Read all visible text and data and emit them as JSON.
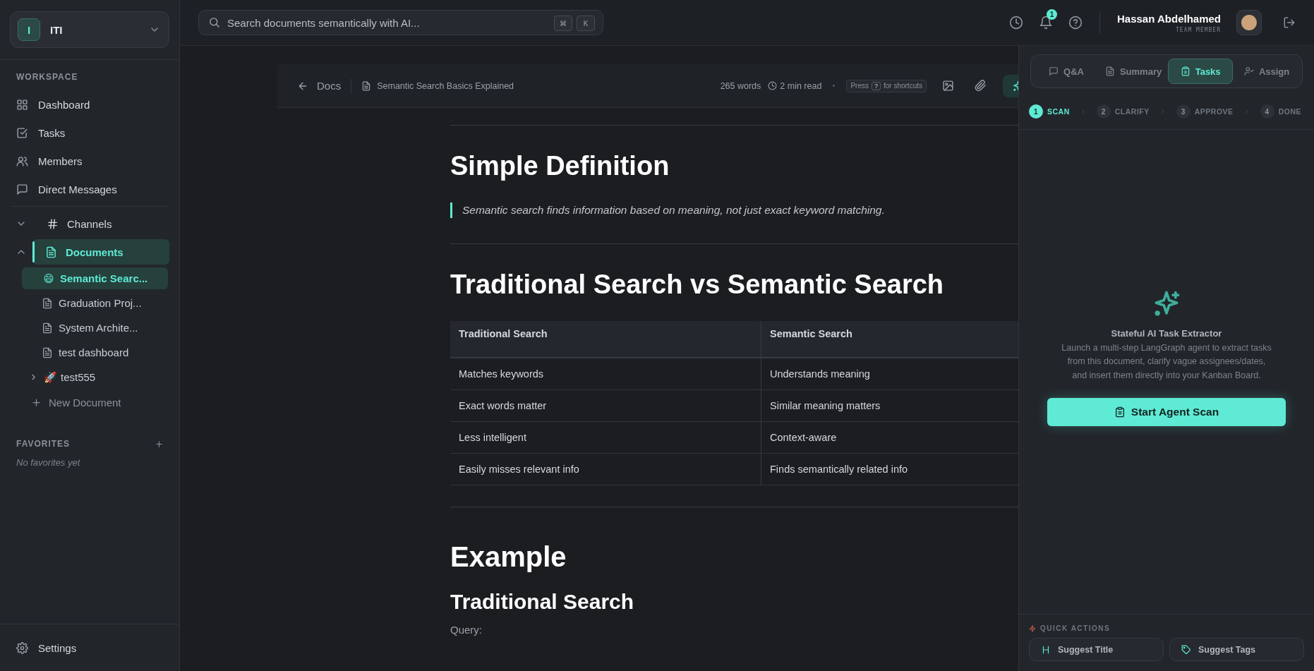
{
  "workspace": {
    "initial": "I",
    "name": "ITI"
  },
  "sidebar": {
    "section_title": "WORKSPACE",
    "items": [
      {
        "label": "Dashboard",
        "selected": false
      },
      {
        "label": "Tasks",
        "selected": false
      },
      {
        "label": "Members",
        "selected": false
      },
      {
        "label": "Direct Messages",
        "selected": false
      }
    ],
    "tree": [
      {
        "label": "Channels",
        "expanded": false,
        "selected": false
      },
      {
        "label": "Documents",
        "expanded": true,
        "selected": true,
        "children": [
          {
            "emoji": "😄",
            "label": "Semantic Searc...",
            "selected": true
          },
          {
            "label": "Graduation Proj...",
            "selected": false
          },
          {
            "label": "System Archite...",
            "selected": false
          },
          {
            "label": "test dashboard",
            "selected": false
          },
          {
            "emoji": "🚀",
            "label": "test555",
            "selected": false,
            "expanded": false
          }
        ]
      }
    ],
    "new_document": "New Document",
    "favorites": {
      "title": "FAVORITES",
      "empty": "No favorites yet"
    },
    "settings": "Settings"
  },
  "topbar": {
    "search_placeholder": "Search documents semantically with AI...",
    "keys": [
      "⌘",
      "K"
    ],
    "notification_count": "1",
    "user_name": "Hassan Abdelhamed",
    "user_role": "TEAM MEMBER"
  },
  "editor_header": {
    "back": "Docs",
    "title": "Semantic Search Basics Explained",
    "words": "265 words",
    "read_time": "2 min read",
    "shortcut": {
      "before": "Press",
      "key": "?",
      "after": "for shortcuts"
    }
  },
  "document": [
    {
      "kind": "rule"
    },
    {
      "kind": "h2",
      "text": "Simple Definition"
    },
    {
      "kind": "quote",
      "text": "Semantic search finds information based on meaning, not just exact keyword matching."
    },
    {
      "kind": "rule"
    },
    {
      "kind": "h2",
      "text": "Traditional Search vs Semantic Search"
    },
    {
      "kind": "table",
      "columns": [
        "Traditional Search",
        "Semantic Search"
      ],
      "rows": [
        [
          "Matches keywords",
          "Understands meaning"
        ],
        [
          "Exact words matter",
          "Similar meaning matters"
        ],
        [
          "Less intelligent",
          "Context-aware"
        ],
        [
          "Easily misses relevant info",
          "Finds semantically related info"
        ]
      ]
    },
    {
      "kind": "rule"
    },
    {
      "kind": "h1",
      "text": "Example"
    },
    {
      "kind": "h3",
      "text": "Traditional Search"
    },
    {
      "kind": "p",
      "text": "Query:"
    }
  ],
  "panel": {
    "tabs": [
      {
        "label": "Q&A",
        "selected": false
      },
      {
        "label": "Summary",
        "selected": false
      },
      {
        "label": "Tasks",
        "selected": true
      },
      {
        "label": "Assign",
        "selected": false
      }
    ],
    "steps": [
      {
        "number": "1",
        "label": "SCAN",
        "selected": true
      },
      {
        "number": "2",
        "label": "CLARIFY",
        "selected": false
      },
      {
        "number": "3",
        "label": "APPROVE",
        "selected": false
      },
      {
        "number": "4",
        "label": "DONE",
        "selected": false
      }
    ],
    "title": "Stateful AI Task Extractor",
    "description": "Launch a multi-step LangGraph agent to extract tasks from this document, clarify vague assignees/dates, and insert them directly into your Kanban Board.",
    "button": "Start Agent Scan",
    "quick_actions_title": "QUICK ACTIONS",
    "quick_actions": [
      "Suggest Title",
      "Suggest Tags"
    ]
  }
}
